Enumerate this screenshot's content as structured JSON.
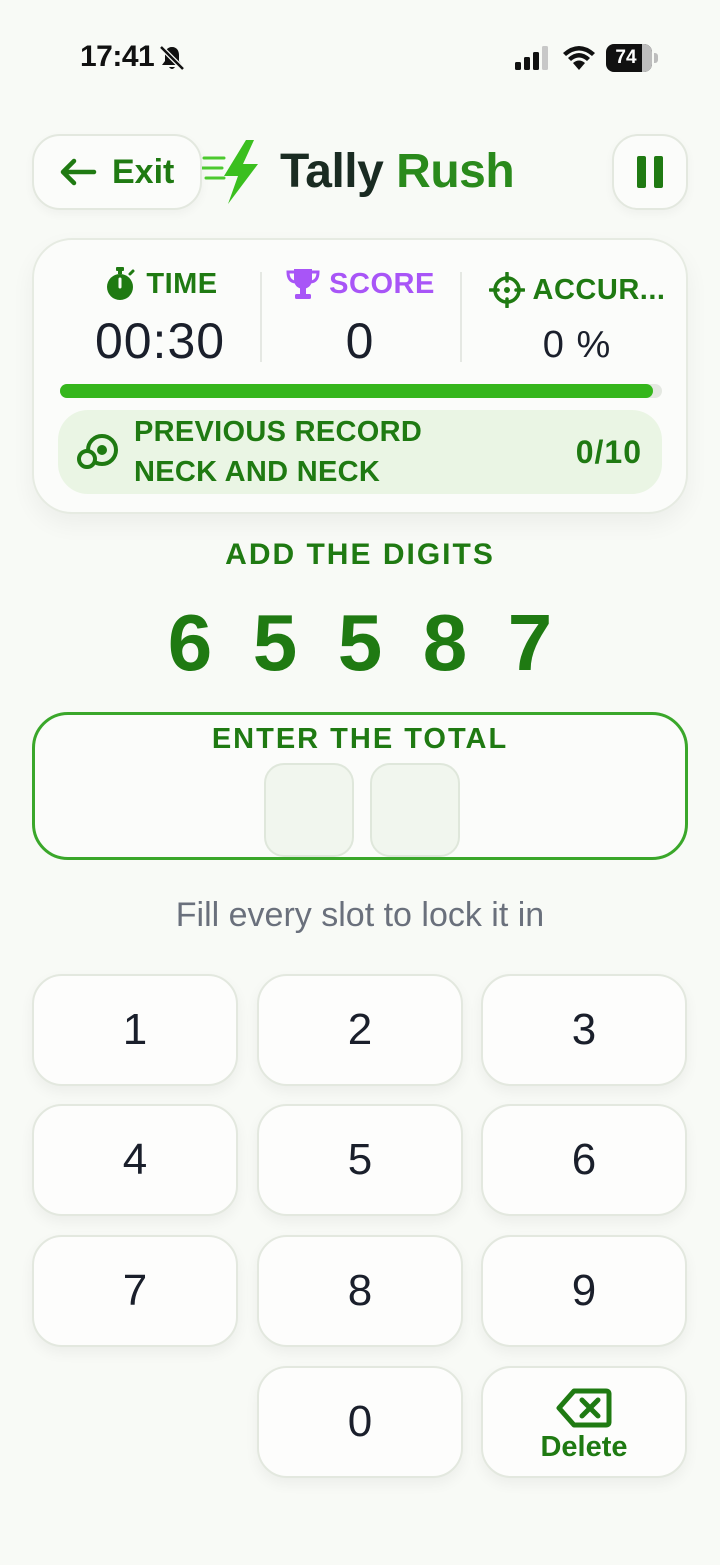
{
  "status_bar": {
    "time": "17:41",
    "battery": "74"
  },
  "header": {
    "exit_label": "Exit",
    "title_part1": "Tally",
    "title_part2": "Rush"
  },
  "stats": {
    "time_label": "TIME",
    "time_value": "00:30",
    "score_label": "SCORE",
    "score_value": "0",
    "accuracy_label": "ACCUR...",
    "accuracy_value": "0 %",
    "progress": 0.985,
    "record_line1": "PREVIOUS RECORD",
    "record_line2": "NECK AND NECK",
    "record_score": "0/10"
  },
  "prompt": {
    "label": "ADD THE DIGITS",
    "digits": [
      "6",
      "5",
      "5",
      "8",
      "7"
    ]
  },
  "answer": {
    "label": "ENTER THE TOTAL",
    "slots": [
      "",
      ""
    ]
  },
  "hint": "Fill every slot to lock it in",
  "keypad": {
    "keys": [
      "1",
      "2",
      "3",
      "4",
      "5",
      "6",
      "7",
      "8",
      "9",
      "0"
    ],
    "delete_label": "Delete"
  },
  "colors": {
    "accent": "#1f7a12",
    "progress": "#35b61c",
    "score_purple": "#a855f7",
    "background": "#f8faf6"
  },
  "icons": [
    "bell-slash-icon",
    "signal-icon",
    "wifi-icon",
    "battery-icon",
    "arrow-left-icon",
    "lightning-bolt-icon",
    "pause-icon",
    "stopwatch-icon",
    "trophy-icon",
    "crosshair-icon",
    "record-icon",
    "backspace-icon"
  ]
}
